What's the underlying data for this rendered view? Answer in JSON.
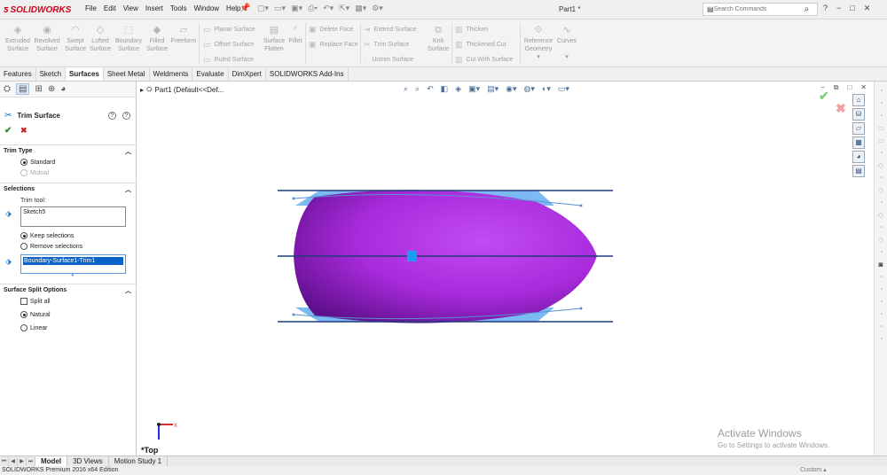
{
  "app": {
    "brand": "SOLIDWORKS",
    "document_title": "Part1 *",
    "menus": [
      "File",
      "Edit",
      "View",
      "Insert",
      "Tools",
      "Window",
      "Help"
    ],
    "search_placeholder": "Search Commands",
    "window_controls": [
      "?",
      "−",
      "□",
      "✕"
    ]
  },
  "ribbon": {
    "large_buttons": [
      {
        "label": "Extruded\nSurface",
        "icon": "extruded-surface-icon"
      },
      {
        "label": "Revolved\nSurface",
        "icon": "revolved-surface-icon"
      },
      {
        "label": "Swept\nSurface",
        "icon": "swept-surface-icon"
      },
      {
        "label": "Lofted\nSurface",
        "icon": "lofted-surface-icon"
      },
      {
        "label": "Boundary\nSurface",
        "icon": "boundary-surface-icon"
      },
      {
        "label": "Filled\nSurface",
        "icon": "filled-surface-icon"
      },
      {
        "label": "Freeform",
        "icon": "freeform-icon"
      }
    ],
    "col1": [
      "Planar Surface",
      "Offset Surface",
      "Ruled Surface"
    ],
    "surface_flatten": "Surface\nFlatten",
    "fillet": "Fillet",
    "col2": [
      "Delete Face",
      "Replace Face"
    ],
    "col3": [
      "Extend Surface",
      "Trim Surface",
      "Untrim Surface"
    ],
    "knit_surface": "Knit\nSurface",
    "col4": [
      "Thicken",
      "Thickened Cut",
      "Cut With Surface"
    ],
    "reference_geometry": "Reference\nGeometry",
    "curves": "Curves"
  },
  "tabs": [
    "Features",
    "Sketch",
    "Surfaces",
    "Sheet Metal",
    "Weldments",
    "Evaluate",
    "DimXpert",
    "SOLIDWORKS Add-Ins"
  ],
  "active_tab": "Surfaces",
  "property_manager": {
    "title": "Trim Surface",
    "trim_type": {
      "header": "Trim Type",
      "options": [
        "Standard",
        "Mutual"
      ],
      "selected": "Standard"
    },
    "selections": {
      "header": "Selections",
      "trim_tool_label": "Trim tool:",
      "trim_tool_value": "Sketch5",
      "keep_options": [
        "Keep selections",
        "Remove selections"
      ],
      "keep_selected": "Keep selections",
      "selected_item": "Boundary-Surface1-Trim1"
    },
    "split_options": {
      "header": "Surface Split Options",
      "split_all": "Split all",
      "natural": "Natural",
      "linear": "Linear",
      "selected": "Natural"
    }
  },
  "graphics": {
    "feature_tree_root": "Part1  (Default<<Def...",
    "view_orientation": "*Top",
    "triad_x_label": "X",
    "surface_color": "#b32fe6",
    "surface_shadow_color": "#5f0f8c",
    "sketch_color": "#6db3f2",
    "line_color": "#1f3b7a"
  },
  "watermark": {
    "line1": "Activate Windows",
    "line2": "Go to Settings to activate Windows."
  },
  "bottom_tabs": [
    "Model",
    "3D Views",
    "Motion Study 1"
  ],
  "active_bottom_tab": "Model",
  "status": {
    "edition": "SOLIDWORKS Premium 2016 x64 Edition",
    "units": "Custom"
  }
}
